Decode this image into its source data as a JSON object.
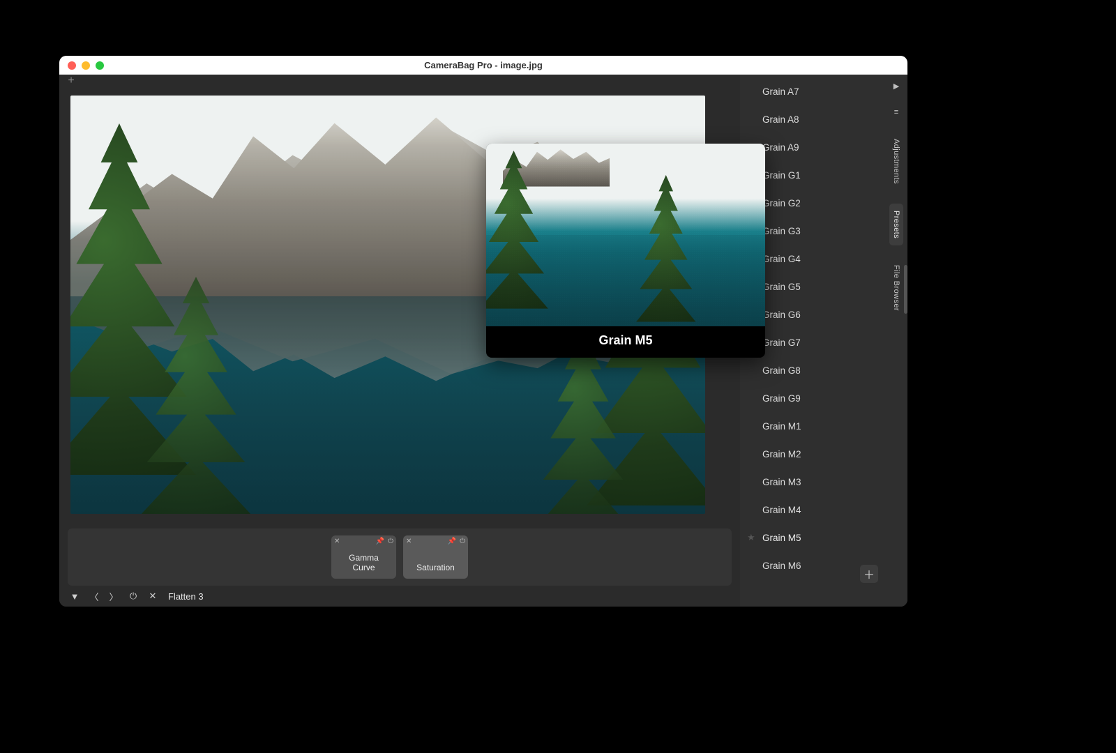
{
  "window": {
    "title": "CameraBag Pro - image.jpg"
  },
  "tray": {
    "tiles": [
      {
        "label": "Gamma\nCurve"
      },
      {
        "label": "Saturation"
      }
    ]
  },
  "footer": {
    "label": "Flatten 3"
  },
  "presets": {
    "items": [
      "Grain A7",
      "Grain A8",
      "Grain A9",
      "Grain G1",
      "Grain G2",
      "Grain G3",
      "Grain G4",
      "Grain G5",
      "Grain G6",
      "Grain G7",
      "Grain G8",
      "Grain G9",
      "Grain M1",
      "Grain M2",
      "Grain M3",
      "Grain M4",
      "Grain M5",
      "Grain M6"
    ],
    "selected": "Grain M5"
  },
  "rail": {
    "tabs": [
      "Adjustments",
      "Presets",
      "File Browser"
    ],
    "active": "Presets"
  },
  "popover": {
    "title": "Grain M5"
  }
}
